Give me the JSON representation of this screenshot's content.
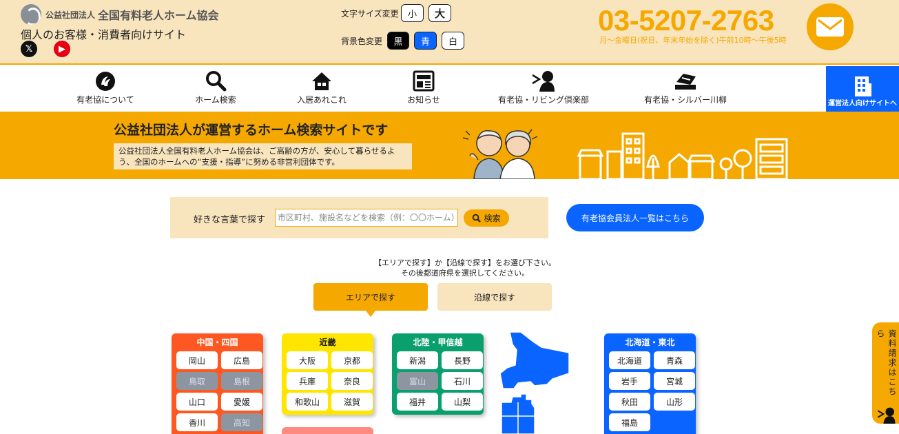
{
  "header": {
    "logo_small": "公益社団法人",
    "logo_name": "全国有料老人ホーム協会",
    "site_sub": "個人のお客様・消費者向けサイト",
    "sns": {
      "x": "𝕏",
      "youtube": "▶"
    },
    "font_size_label": "文字サイズ変更",
    "font_small": "小",
    "font_large": "大",
    "bg_label": "背景色変更",
    "bg_black": "黒",
    "bg_blue": "青",
    "bg_white": "白",
    "phone": "03-5207-2763",
    "phone_note": "月～金曜日(祝日、年末年始を除く)午前10時～午後5時"
  },
  "nav": {
    "items": [
      {
        "label": "有老協について",
        "icon": "logo-icon"
      },
      {
        "label": "ホーム検索",
        "icon": "search-icon"
      },
      {
        "label": "入居あれこれ",
        "icon": "home-icon"
      },
      {
        "label": "お知らせ",
        "icon": "news-icon"
      },
      {
        "label": "有老協・リビング倶楽部",
        "icon": "person-icon"
      },
      {
        "label": "有老協・シルバー川柳",
        "icon": "book-icon"
      }
    ],
    "corp_label": "運営法人向けサイトへ"
  },
  "hero": {
    "title": "公益社団法人が運営するホーム検索サイトです",
    "desc": "公益社団法人全国有料老人ホーム協会は、ご高齢の方が、安心して暮らせるよう、全国のホームへの“支援・指導”に努める非営利団体です。"
  },
  "search": {
    "label": "好きな言葉で探す",
    "placeholder": "市区町村、施設名などを検索（例：〇〇ホーム）",
    "button": "検索",
    "member_button": "有老協会員法人一覧はこちら"
  },
  "instruction": {
    "line1": "【エリアで探す】か【沿線で探す】をお選び下さい。",
    "line2": "その後都道府県を選択してください。"
  },
  "tabs": {
    "area": "エリアで探す",
    "line": "沿線で探す"
  },
  "regions": {
    "chugoku": {
      "title": "中国・四国",
      "prefs": [
        "岡山",
        "広島",
        "鳥取",
        "島根",
        "山口",
        "愛媛",
        "香川",
        "高知"
      ],
      "disabled": [
        2,
        3,
        7
      ]
    },
    "kinki": {
      "title": "近畿",
      "prefs": [
        "大阪",
        "京都",
        "兵庫",
        "奈良",
        "和歌山",
        "滋賀"
      ]
    },
    "hokuriku": {
      "title": "北陸・甲信越",
      "prefs": [
        "新潟",
        "長野",
        "富山",
        "石川",
        "福井",
        "山梨"
      ],
      "disabled": [
        2
      ]
    },
    "hokkaido": {
      "title": "北海道・東北",
      "prefs": [
        "北海道",
        "青森",
        "岩手",
        "宮城",
        "秋田",
        "山形",
        "福島"
      ]
    }
  },
  "side_tab": {
    "label": "資料請求はこちら"
  },
  "colors": {
    "accent": "#f5a800",
    "cream": "#f8e4bd",
    "blue": "#0a64ff",
    "chugoku": "#ff5722",
    "kinki": "#ffe600",
    "hokuriku": "#0aa06e"
  }
}
